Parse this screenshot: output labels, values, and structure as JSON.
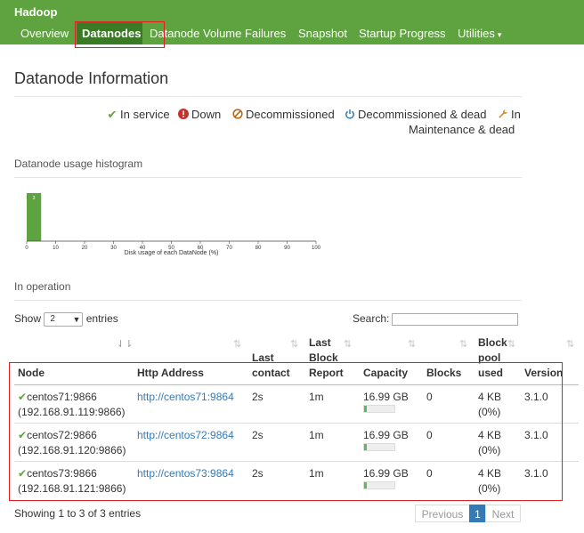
{
  "navbar": {
    "brand": "Hadoop",
    "items": [
      {
        "label": "Overview"
      },
      {
        "label": "Datanodes"
      },
      {
        "label": "Datanode Volume Failures"
      },
      {
        "label": "Snapshot"
      },
      {
        "label": "Startup Progress"
      },
      {
        "label": "Utilities"
      }
    ],
    "active": "Datanodes"
  },
  "page": {
    "title": "Datanode Information"
  },
  "legend": [
    {
      "icon": "check-icon",
      "label": "In service",
      "color": "#5fa341"
    },
    {
      "icon": "exclamation-circle-icon",
      "label": "Down",
      "color": "#c9302c"
    },
    {
      "icon": "ban-icon",
      "label": "Decommissioned",
      "color": "#b46a1a"
    },
    {
      "icon": "power-icon",
      "label": "Decommissioned & dead",
      "color": "#337ab7"
    },
    {
      "icon": "wrench-icon",
      "label_line1": "In",
      "label_line2": "Maintenance & dead",
      "color": "#e08a1e"
    }
  ],
  "histogram": {
    "section_label": "Datanode usage histogram"
  },
  "chart_data": {
    "type": "bar",
    "title": "",
    "xlabel": "Disk usage of each DataNode (%)",
    "ylabel": "",
    "xlim": [
      0,
      100
    ],
    "x_ticks": [
      0,
      10,
      20,
      30,
      40,
      50,
      60,
      70,
      80,
      90,
      100
    ],
    "bins": [
      {
        "x0": 0,
        "x1": 5,
        "value": 3
      }
    ],
    "bar_color": "#5fa341"
  },
  "operation": {
    "section_label": "In operation",
    "show_label": "Show",
    "page_size": "2",
    "entries_label": "entries",
    "search_label": "Search:",
    "search_value": "",
    "columns": {
      "node": "Node",
      "http": "Http Address",
      "last_contact_1": "Last",
      "last_contact_2": "contact",
      "last_block_1": "Last",
      "last_block_2": "Block",
      "last_block_3": "Report",
      "capacity": "Capacity",
      "blocks": "Blocks",
      "pool_1": "Block",
      "pool_2": "pool",
      "pool_3": "used",
      "version": "Version"
    },
    "rows": [
      {
        "node": "centos71:9866",
        "ip": "(192.168.91.119:9866)",
        "http": "http://centos71:9864",
        "last_contact": "2s",
        "last_block": "1m",
        "capacity": "16.99 GB",
        "usage": 0.08,
        "blocks": "0",
        "pool_used": "4 KB",
        "pool_pct": "(0%)",
        "version": "3.1.0"
      },
      {
        "node": "centos72:9866",
        "ip": "(192.168.91.120:9866)",
        "http": "http://centos72:9864",
        "last_contact": "2s",
        "last_block": "1m",
        "capacity": "16.99 GB",
        "usage": 0.08,
        "blocks": "0",
        "pool_used": "4 KB",
        "pool_pct": "(0%)",
        "version": "3.1.0"
      },
      {
        "node": "centos73:9866",
        "ip": "(192.168.91.121:9866)",
        "http": "http://centos73:9864",
        "last_contact": "2s",
        "last_block": "1m",
        "capacity": "16.99 GB",
        "usage": 0.08,
        "blocks": "0",
        "pool_used": "4 KB",
        "pool_pct": "(0%)",
        "version": "3.1.0"
      }
    ],
    "info": "Showing 1 to 3 of 3 entries",
    "pagination": {
      "previous": "Previous",
      "current": "1",
      "next": "Next"
    }
  }
}
